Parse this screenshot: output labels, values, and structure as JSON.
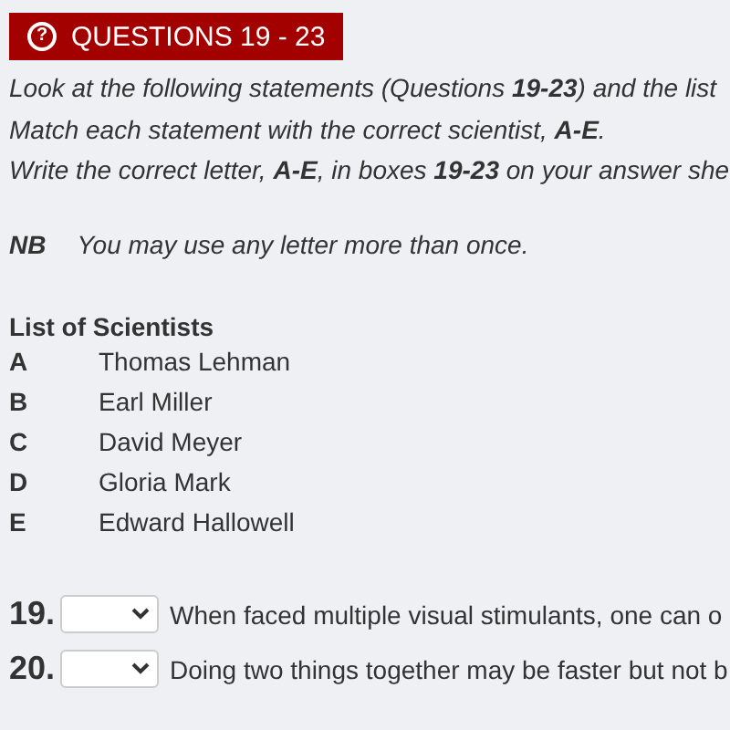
{
  "header": {
    "icon": "?",
    "title": "QUESTIONS 19 - 23"
  },
  "instructions": [
    "Look at the following statements (Questions **19-23**) and the list",
    "Match each statement with the correct scientist, **A-E**.",
    "Write the correct letter, **A-E**, in boxes **19-23** on your answer she"
  ],
  "note": {
    "label": "NB",
    "text": "You may use any letter more than once."
  },
  "list_title": "List of Scientists",
  "scientists": [
    {
      "letter": "A",
      "name": "Thomas Lehman"
    },
    {
      "letter": "B",
      "name": "Earl Miller"
    },
    {
      "letter": "C",
      "name": "David Meyer"
    },
    {
      "letter": "D",
      "name": "Gloria Mark"
    },
    {
      "letter": "E",
      "name": "Edward Hallowell"
    }
  ],
  "questions": [
    {
      "number": "19.",
      "statement": "When faced multiple visual stimulants, one can o"
    },
    {
      "number": "20.",
      "statement": "Doing two things together may be faster but not b"
    }
  ]
}
